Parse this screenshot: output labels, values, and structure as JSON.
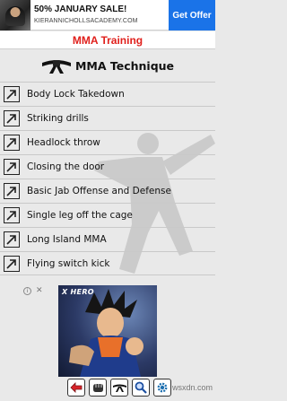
{
  "ad_banner": {
    "headline": "50% JANUARY SALE!",
    "url": "KIERANNICHOLLSACADEMY.COM",
    "cta": "Get Offer"
  },
  "app": {
    "title": "MMA Training"
  },
  "section": {
    "title": "MMA Technique",
    "icon": "black-belt-icon"
  },
  "techniques": [
    "Body Lock Takedown",
    "Striking drills",
    "Headlock throw",
    "Closing the door",
    "Basic Jab Offense and Defense",
    "Single leg off the cage",
    "Long Island MMA",
    "Flying switch kick"
  ],
  "ad_image": {
    "title": "X HERO"
  },
  "toolbar": {
    "buttons": [
      "back-arrow-icon",
      "fist-icon",
      "belt-icon",
      "magnifier-icon",
      "settings-gear-icon"
    ]
  },
  "site_watermark": "wsxdn.com",
  "colors": {
    "title_red": "#e0201c",
    "ad_blue": "#1a73e8",
    "background": "#e9e9e9"
  }
}
